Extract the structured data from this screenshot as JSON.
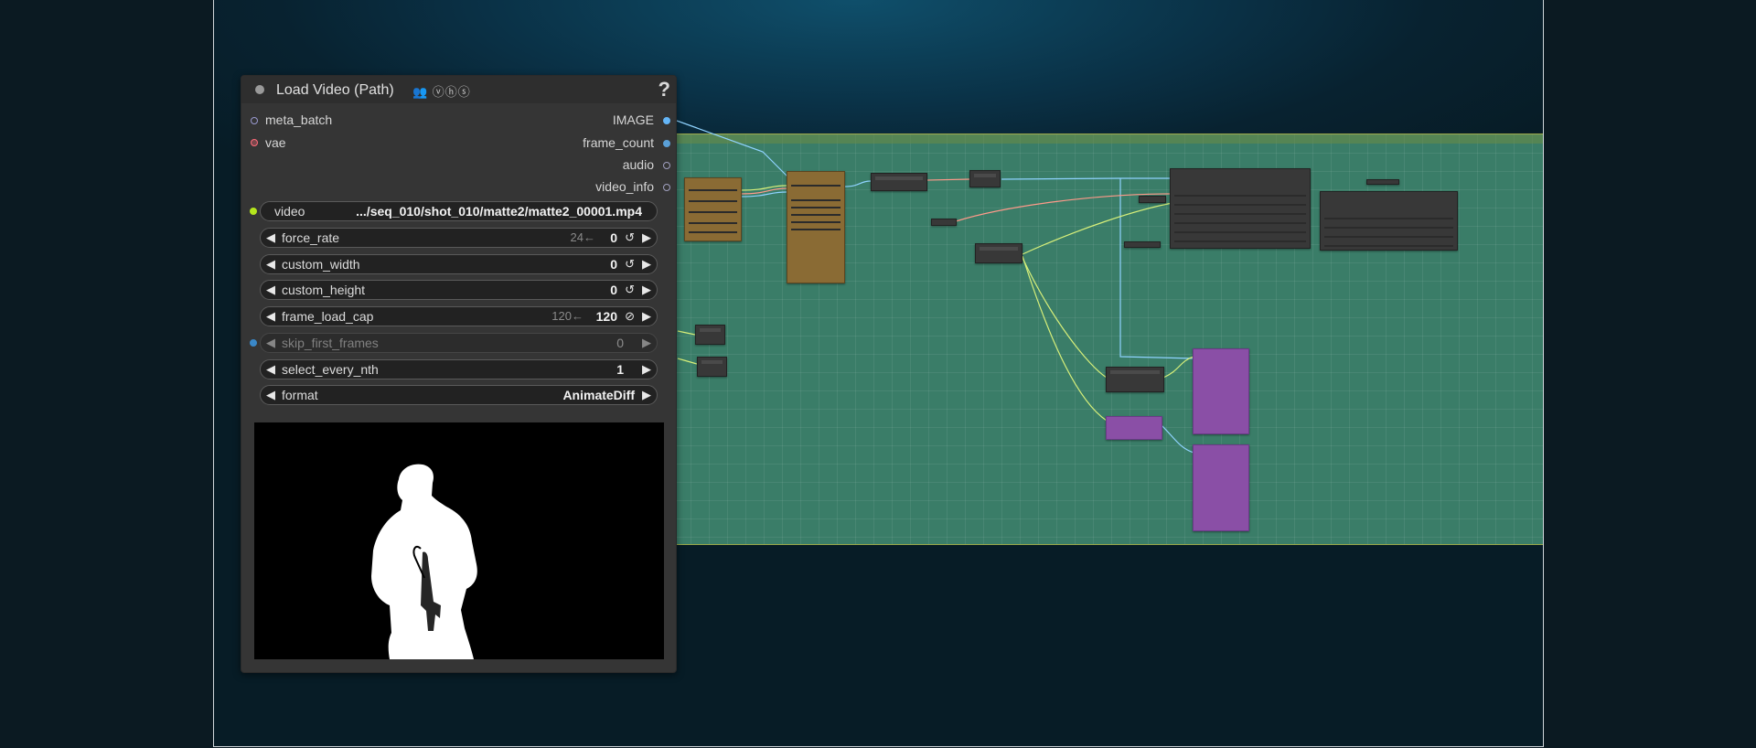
{
  "node": {
    "title": "Load Video (Path)",
    "badges": "👥 ⓥⓗⓢ",
    "help": "?",
    "inputs": [
      {
        "label": "meta_batch",
        "color": "#9a9ad0"
      },
      {
        "label": "vae",
        "color": "#ff6b7a"
      }
    ],
    "outputs": [
      {
        "label": "IMAGE",
        "color": "#64b5f6"
      },
      {
        "label": "frame_count",
        "color": "#5aa0d8"
      },
      {
        "label": "audio",
        "color": "#a0a0c0"
      },
      {
        "label": "video_info",
        "color": "#a0a0c0"
      }
    ],
    "video": {
      "label": "video",
      "value": ".../seq_010/shot_010/matte2/matte2_00001.mp4"
    },
    "widgets": {
      "force_rate": {
        "label": "force_rate",
        "default": "24←",
        "value": "0",
        "reset": "↺"
      },
      "custom_width": {
        "label": "custom_width",
        "value": "0",
        "reset": "↺"
      },
      "custom_height": {
        "label": "custom_height",
        "value": "0",
        "reset": "↺"
      },
      "frame_load_cap": {
        "label": "frame_load_cap",
        "default": "120←",
        "value": "120",
        "reset": "⊘"
      },
      "skip_first_frames": {
        "label": "skip_first_frames",
        "value": "0"
      },
      "select_every_nth": {
        "label": "select_every_nth",
        "value": "1"
      },
      "format": {
        "label": "format",
        "value": "AnimateDiff"
      }
    }
  },
  "colors": {
    "wire_blue": "#8fd3ff",
    "wire_yellow": "#d8f07a",
    "wire_pink": "#ff9a8a",
    "group_bg": "#3a7d68"
  }
}
